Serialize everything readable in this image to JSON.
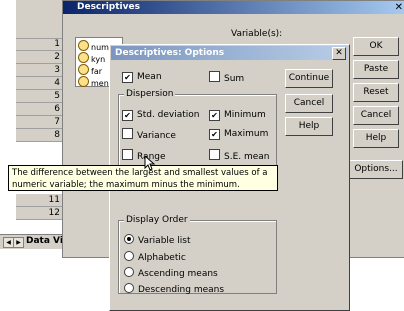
{
  "spreadsheet": {
    "row_numbers": [
      "1",
      "2",
      "3",
      "4",
      "5",
      "6",
      "7",
      "8",
      "9",
      "10",
      "11",
      "12"
    ],
    "tab_label": "Data View"
  },
  "descriptives": {
    "title": "Descriptives",
    "variables_label": "Variable(s):",
    "variables": [
      "num",
      "kyn",
      "far",
      "men"
    ],
    "buttons": [
      "OK",
      "Paste",
      "Reset",
      "Cancel",
      "Help",
      "Options..."
    ]
  },
  "options": {
    "title": "Descriptives: Options",
    "mean": {
      "label": "Mean",
      "checked": true
    },
    "sum": {
      "label": "Sum",
      "checked": false
    },
    "dispersion_label": "Dispersion",
    "dispersion": [
      {
        "label": "Std. deviation",
        "checked": true
      },
      {
        "label": "Minimum",
        "checked": true
      },
      {
        "label": "Variance",
        "checked": false
      },
      {
        "label": "Maximum",
        "checked": true
      },
      {
        "label": "Range",
        "checked": false
      },
      {
        "label": "S.E. mean",
        "checked": false
      }
    ],
    "buttons": {
      "continue": "Continue",
      "cancel": "Cancel",
      "help": "Help"
    },
    "display_order_label": "Display Order",
    "display_order": [
      {
        "label": "Variable list",
        "selected": true
      },
      {
        "label": "Alphabetic",
        "selected": false
      },
      {
        "label": "Ascending means",
        "selected": false
      },
      {
        "label": "Descending means",
        "selected": false
      }
    ]
  },
  "tooltip": {
    "line1": "The difference between the largest and smallest values of a",
    "line2": "numeric variable; the maximum minus the minimum."
  }
}
